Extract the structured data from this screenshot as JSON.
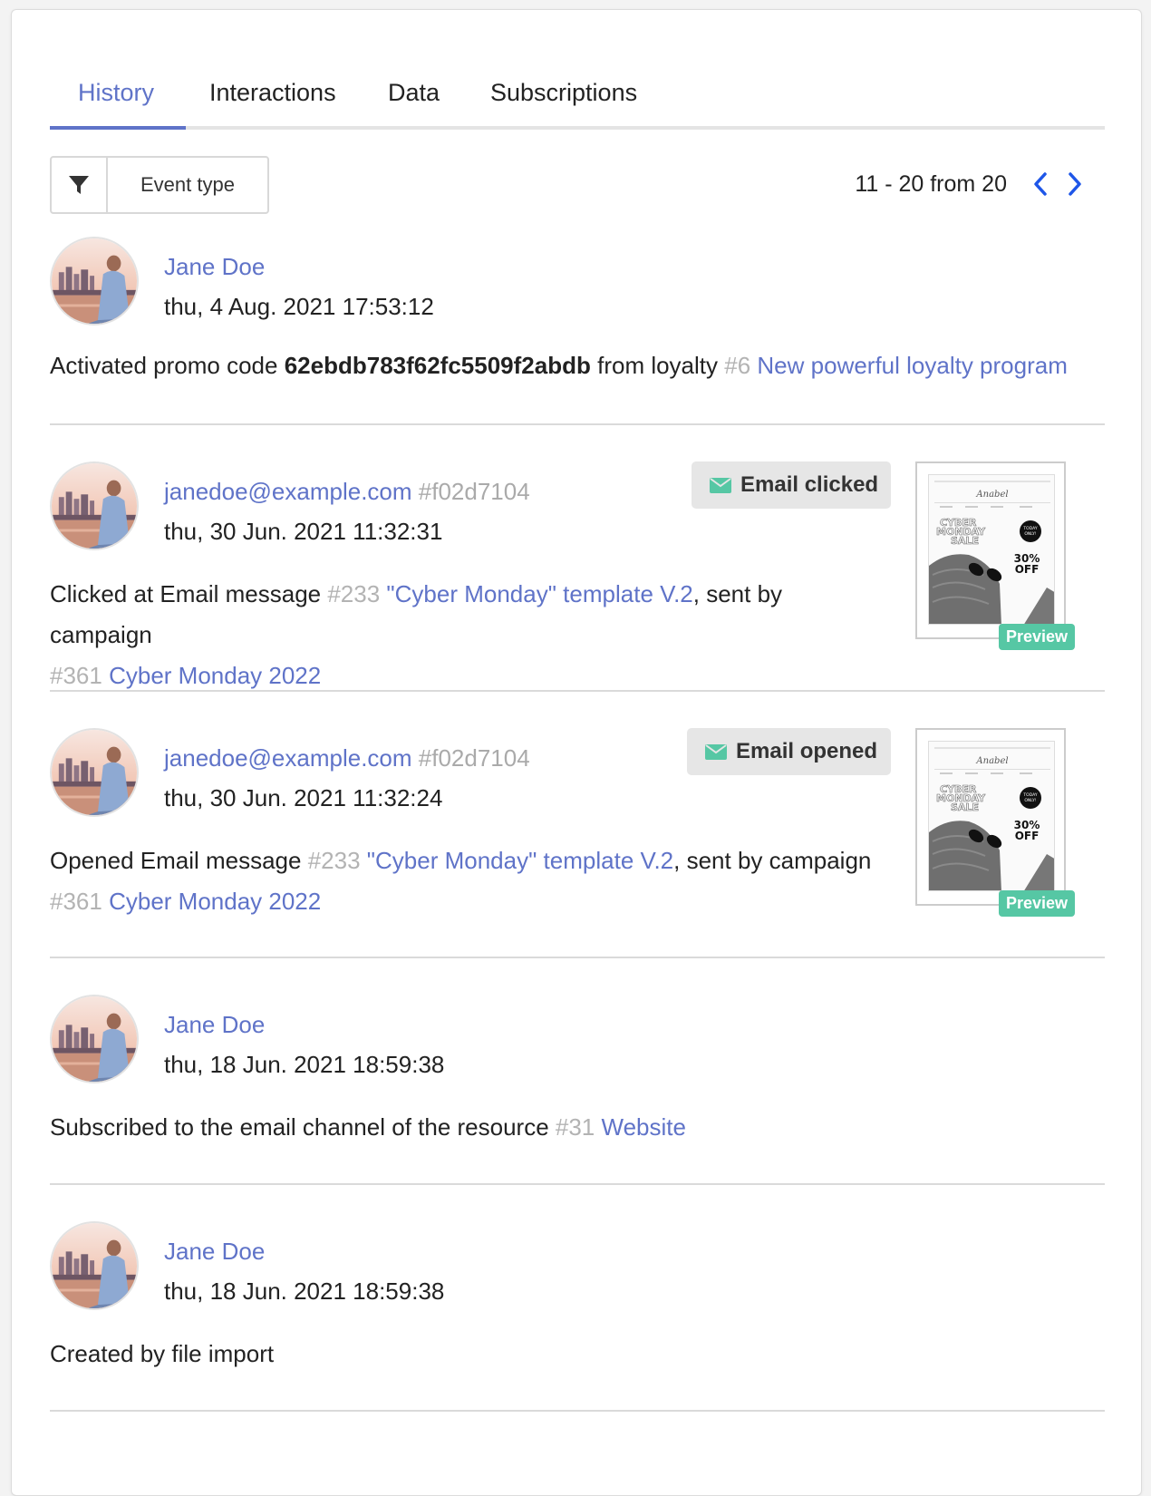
{
  "tabs": [
    {
      "label": "History"
    },
    {
      "label": "Interactions"
    },
    {
      "label": "Data"
    },
    {
      "label": "Subscriptions"
    }
  ],
  "filter": {
    "label": "Event type"
  },
  "pagination": {
    "text": "11 - 20 from 20"
  },
  "events": [
    {
      "author": "Jane Doe",
      "date": "thu, 4 Aug. 2021 17:53:12",
      "desc_text1": "Activated promo code ",
      "promo_code": "62ebdb783f62fc5509f2abdb",
      "desc_text2": " from loyalty ",
      "loyalty_hash": "#6",
      "loyalty_link": "New powerful loyalty program"
    },
    {
      "author": "janedoe@example.com",
      "author_hash": "#f02d7104",
      "date": "thu, 30 Jun. 2021 11:32:31",
      "badge": "Email clicked",
      "desc_text1": "Clicked at Email message ",
      "msg_hash": "#233",
      "msg_link": "\"Cyber Monday\" template V.2",
      "desc_text2": ", sent by campaign",
      "camp_hash": "#361",
      "camp_link": "Cyber Monday 2022",
      "preview_label": "Preview"
    },
    {
      "author": "janedoe@example.com",
      "author_hash": "#f02d7104",
      "date": "thu, 30 Jun. 2021 11:32:24",
      "badge": "Email opened",
      "desc_text1": "Opened Email message ",
      "msg_hash": "#233",
      "msg_link": "\"Cyber Monday\" template V.2",
      "desc_text2": ", sent by campaign",
      "camp_hash": "#361",
      "camp_link": "Cyber Monday 2022",
      "preview_label": "Preview"
    },
    {
      "author": "Jane Doe",
      "date": "thu, 18 Jun. 2021 18:59:38",
      "desc_text1": "Subscribed to the email channel of the resource ",
      "res_hash": "#31",
      "res_link": "Website"
    },
    {
      "author": "Jane Doe",
      "date": "thu, 18 Jun. 2021 18:59:38",
      "desc_text1": "Created by file import"
    }
  ],
  "thumbnail": {
    "brand": "Anabel",
    "headline": "CYBER MONDAY SALE",
    "sticker": "TODAY ONLY!",
    "discount": "30% OFF"
  },
  "colors": {
    "accent": "#5f73c8",
    "preview": "#56c7a4",
    "badge_icon": "#56c7a4"
  }
}
